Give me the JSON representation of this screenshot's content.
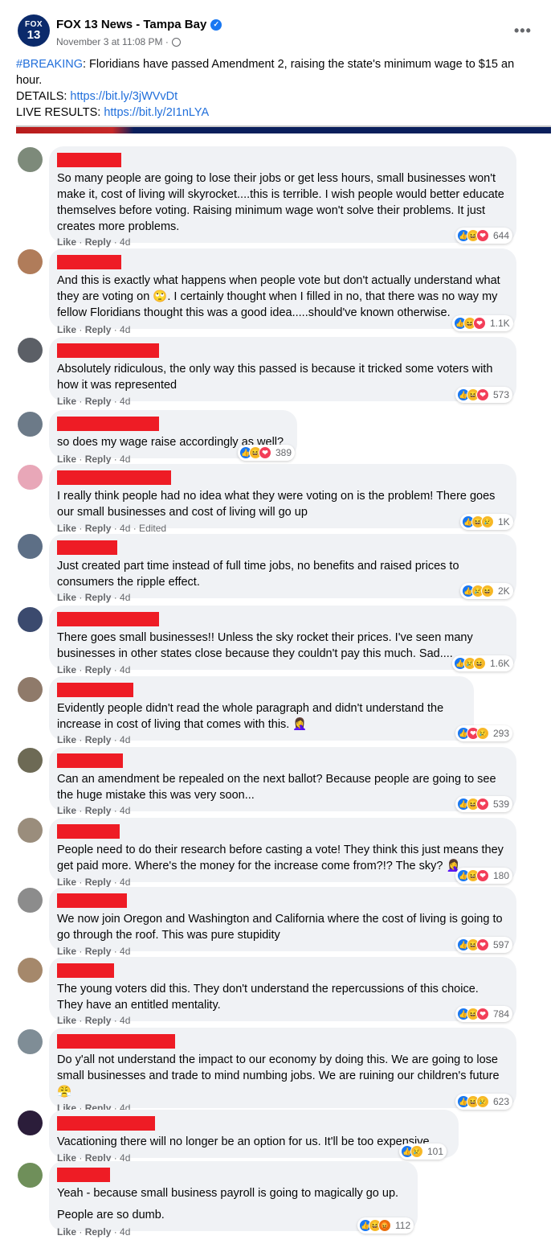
{
  "post": {
    "page_name": "FOX 13 News - Tampa Bay",
    "logo_line1": "FOX",
    "logo_line2": "13",
    "meta": "November 3 at 11:08 PM ·",
    "tag": "#BREAKING",
    "text_after_tag": ": Floridians have passed Amendment 2, raising the state's minimum wage to $15 an hour.",
    "details_label": "DETAILS: ",
    "details_link": "https://bit.ly/3jWVvDt",
    "results_label": "LIVE RESULTS: ",
    "results_link": "https://bit.ly/2I1nLYA",
    "more_label": "•••"
  },
  "labels": {
    "like": "Like",
    "reply": "Reply"
  },
  "comments": [
    {
      "text": "So many people are going to lose their jobs or get less hours, small businesses won't make it, cost of living will skyrocket....this is terrible. I wish people would better educate themselves before voting. Raising minimum wage won't solve their problems. It just creates more problems.",
      "time": "4d",
      "reactions": [
        "like",
        "haha",
        "love"
      ],
      "count": "644"
    },
    {
      "text": "And this is exactly what happens when people vote but don't actually understand what they are voting on 🙄. I certainly thought when I filled in no, that there was no way my fellow Floridians thought this was a good idea.....should've known otherwise.",
      "time": "4d",
      "reactions": [
        "like",
        "haha",
        "love"
      ],
      "count": "1.1K"
    },
    {
      "text": "Absolutely ridiculous, the only way this passed is because it tricked some voters with how it was represented",
      "time": "4d",
      "reactions": [
        "like",
        "haha",
        "love"
      ],
      "count": "573"
    },
    {
      "text": "so does my wage raise accordingly as well?",
      "time": "4d",
      "reactions": [
        "like",
        "haha",
        "love"
      ],
      "count": "389"
    },
    {
      "text": "I really think people had no idea what they were voting on is the problem! There goes our small businesses and cost of living will go up",
      "time": "4d · Edited",
      "reactions": [
        "like",
        "haha",
        "sad"
      ],
      "count": "1K"
    },
    {
      "text": "Just created part time instead of full time jobs, no benefits and raised prices to consumers the ripple effect.",
      "time": "4d",
      "reactions": [
        "like",
        "sad",
        "haha"
      ],
      "count": "2K"
    },
    {
      "text": "There goes small businesses!! Unless the sky rocket their prices. I've seen many businesses in other states close because they couldn't pay this much. Sad....",
      "time": "4d",
      "reactions": [
        "like",
        "sad",
        "haha"
      ],
      "count": "1.6K"
    },
    {
      "text": "Evidently people didn't read the whole paragraph and didn't understand the increase in cost of living that comes with this. 🤦‍♀️",
      "time": "4d",
      "reactions": [
        "like",
        "love",
        "sad"
      ],
      "count": "293"
    },
    {
      "text": "Can an amendment be repealed on the next ballot? Because people are going to see the huge mistake this was very soon...",
      "time": "4d",
      "reactions": [
        "like",
        "haha",
        "love"
      ],
      "count": "539"
    },
    {
      "text": "People need to do their research before casting a vote! They think this just means they get paid more. Where's the money for the increase come from?!? The sky? 🤦‍♀️",
      "time": "4d",
      "reactions": [
        "like",
        "haha",
        "love"
      ],
      "count": "180"
    },
    {
      "text": "We now join Oregon and Washington and California where the cost of living is going to go through the roof. This was pure stupidity",
      "time": "4d",
      "reactions": [
        "like",
        "haha",
        "love"
      ],
      "count": "597"
    },
    {
      "text": "The young voters did this. They don't understand the repercussions of this choice. They have an entitled mentality.",
      "time": "4d",
      "reactions": [
        "like",
        "haha",
        "love"
      ],
      "count": "784"
    },
    {
      "text": "Do y'all not understand the impact to our economy by doing this. We are going to lose small businesses and trade to mind numbing jobs. We are ruining our children's future 😤",
      "time": "4d",
      "reactions": [
        "like",
        "haha",
        "sad"
      ],
      "count": "623"
    },
    {
      "text": "Vacationing there will no longer be an option for us. It'll be too expensive.",
      "time": "4d",
      "reactions": [
        "like",
        "sad"
      ],
      "count": "101"
    },
    {
      "text": "Yeah - because small business payroll is going to magically go up.",
      "text2": "People are so dumb.",
      "time": "4d",
      "reactions": [
        "like",
        "haha",
        "angry"
      ],
      "count": "112"
    }
  ],
  "colors": {
    "accent": "#216fdb",
    "redaction": "#ee1c25",
    "bubble": "#f0f2f5"
  }
}
